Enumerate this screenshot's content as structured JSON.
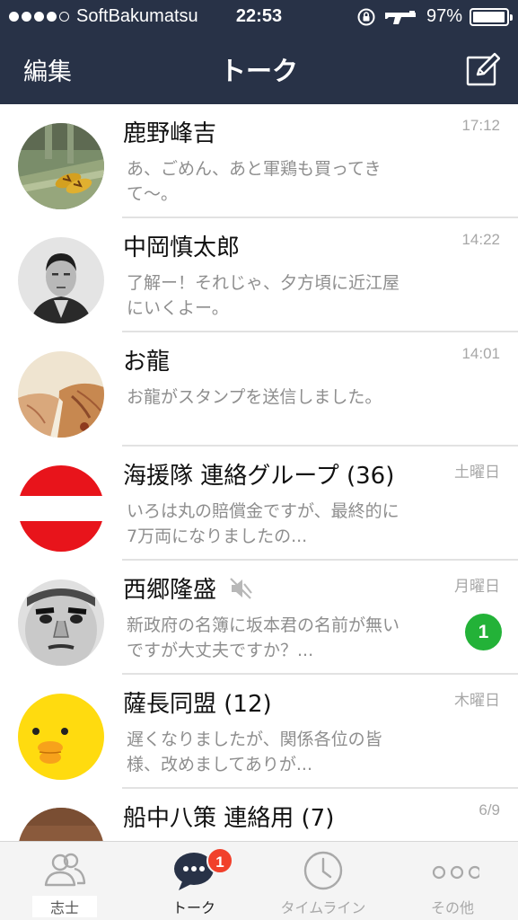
{
  "status_bar": {
    "carrier": "SoftBakumatsu",
    "time": "22:53",
    "battery_percent": "97%",
    "signal_bars": 4,
    "battery_level": 0.97
  },
  "nav": {
    "edit_label": "編集",
    "title": "トーク",
    "compose_icon": "compose-icon"
  },
  "chats": [
    {
      "name": "鹿野峰吉",
      "time": "17:12",
      "preview": "あ、ごめん、あと軍鶏も買ってきて〜。",
      "avatar": "sandals-photo"
    },
    {
      "name": "中岡慎太郎",
      "time": "14:22",
      "preview": "了解ー！それじゃ、夕方頃に近江屋にいくよー。",
      "avatar": "portrait-photo"
    },
    {
      "name": "お龍",
      "time": "14:01",
      "preview": "お龍がスタンプを送信しました。",
      "avatar": "kimono-photo"
    },
    {
      "name": "海援隊 連絡グループ (36)",
      "time": "土曜日",
      "preview": "いろは丸の賠償金ですが、最終的に7万両になりましたの...",
      "avatar": "red-white-flag"
    },
    {
      "name": "西郷隆盛",
      "time": "月曜日",
      "preview": "新政府の名簿に坂本君の名前が無いですが大丈夫ですか？...",
      "avatar": "saigo-portrait",
      "muted": true,
      "unread": "1"
    },
    {
      "name": "薩長同盟 (12)",
      "time": "木曜日",
      "preview": "遅くなりましたが、関係各位の皆様、改めましてありが...",
      "avatar": "yellow-chick-sticker"
    },
    {
      "name": "船中八策 連絡用 (7)",
      "time": "6/9",
      "preview": "",
      "avatar": "brown-bear-sticker"
    }
  ],
  "tabs": [
    {
      "label": "志士",
      "icon": "friends-icon"
    },
    {
      "label": "トーク",
      "icon": "chat-bubble-icon",
      "badge": "1",
      "active": true
    },
    {
      "label": "タイムライン",
      "icon": "clock-icon"
    },
    {
      "label": "その他",
      "icon": "more-dots-icon"
    }
  ],
  "colors": {
    "header_bg": "#283247",
    "unread_badge": "#23b238",
    "tab_badge": "#f1402b"
  }
}
